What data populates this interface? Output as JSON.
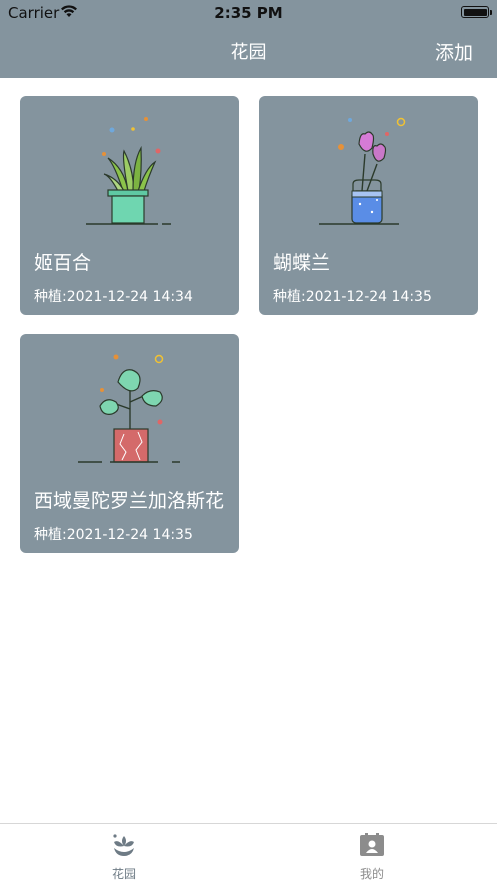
{
  "status_bar": {
    "carrier": "Carrier",
    "time": "2:35 PM"
  },
  "nav": {
    "title": "花园",
    "add_label": "添加"
  },
  "plants": [
    {
      "name": "姬百合",
      "date_label": "种植:",
      "date": "2021-12-24 14:34",
      "icon": "snake-plant-pot-icon"
    },
    {
      "name": "蝴蝶兰",
      "date_label": "种植:",
      "date": "2021-12-24 14:35",
      "icon": "tulip-vase-icon"
    },
    {
      "name": "西域曼陀罗兰加洛斯花",
      "date_label": "种植:",
      "date": "2021-12-24 14:35",
      "icon": "monstera-pot-icon"
    }
  ],
  "tabs": [
    {
      "label": "花园",
      "icon": "flower-icon",
      "active": true
    },
    {
      "label": "我的",
      "icon": "profile-card-icon",
      "active": false
    }
  ],
  "colors": {
    "header_bg": "#84949e",
    "card_bg": "#84949e",
    "tab_active": "#6e7b85",
    "tab_inactive": "#8c8c8c"
  }
}
